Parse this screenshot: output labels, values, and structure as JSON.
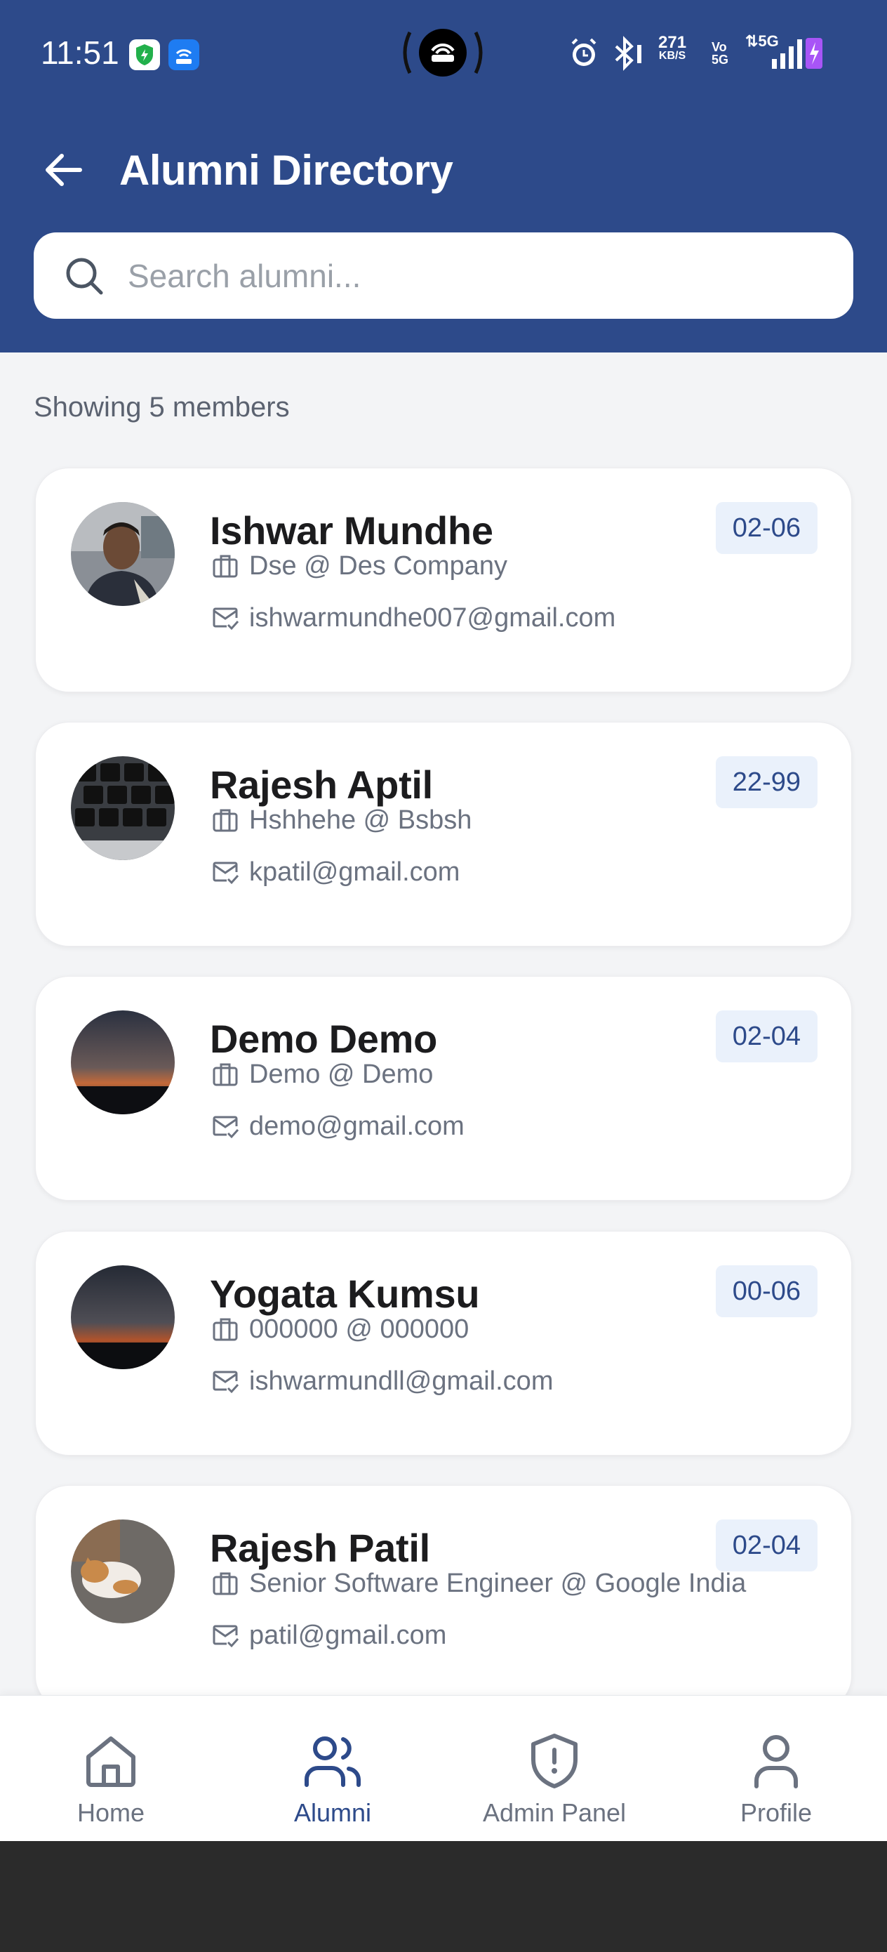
{
  "status_bar": {
    "time": "11:51",
    "speed_value": "271",
    "speed_unit": "KB/S",
    "vo_top": "Vo",
    "vo_bottom": "5G",
    "network": "5G"
  },
  "header": {
    "title": "Alumni Directory",
    "background_color": "#2d4a8a"
  },
  "search": {
    "placeholder": "Search alumni..."
  },
  "members_count_text": "Showing 5 members",
  "members": [
    {
      "name": "Ishwar Mundhe",
      "job": "Dse @ Des Company",
      "email": "ishwarmundhe007@gmail.com",
      "batch": "02-06",
      "avatar": "person-photo"
    },
    {
      "name": "Rajesh Aptil",
      "job": "Hshhehe @ Bsbsh",
      "email": "kpatil@gmail.com",
      "batch": "22-99",
      "avatar": "keyboard-photo"
    },
    {
      "name": "Demo Demo",
      "job": "Demo @ Demo",
      "email": "demo@gmail.com",
      "batch": "02-04",
      "avatar": "sunset-photo"
    },
    {
      "name": "Yogata Kumsu",
      "job": "000000 @ 000000",
      "email": "ishwarmundll@gmail.com",
      "batch": "00-06",
      "avatar": "sunset-photo"
    },
    {
      "name": "Rajesh Patil",
      "job": "Senior Software Engineer @ Google India",
      "email": "patil@gmail.com",
      "batch": "02-04",
      "avatar": "cat-photo"
    }
  ],
  "bottom_nav": [
    {
      "label": "Home",
      "icon": "home-icon",
      "active": false
    },
    {
      "label": "Alumni",
      "icon": "users-icon",
      "active": true
    },
    {
      "label": "Admin Panel",
      "icon": "shield-alert-icon",
      "active": false
    },
    {
      "label": "Profile",
      "icon": "user-icon",
      "active": false
    }
  ],
  "colors": {
    "primary": "#2d4a8a",
    "badge_bg": "#eaf1fb",
    "muted_text": "#6b7280"
  }
}
